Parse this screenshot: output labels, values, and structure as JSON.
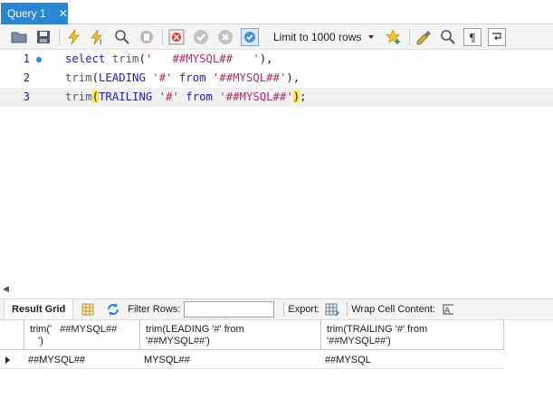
{
  "tab": {
    "title": "Query 1",
    "close_glyph": "✕"
  },
  "toolbar": {
    "icons": [
      "open-folder-icon",
      "save-icon",
      "execute-icon",
      "execute-current-icon",
      "explain-icon",
      "stop-icon",
      "toggle-error-icon",
      "commit-icon",
      "rollback-icon",
      "autocommit-icon"
    ],
    "limit_label": "Limit to 1000 rows",
    "right_icons": [
      "add-snippet-icon",
      "beautify-icon",
      "find-icon",
      "invisible-chars-icon",
      "wrap-icon"
    ]
  },
  "editor": {
    "lines": [
      {
        "number": "1",
        "current": false,
        "tokens": [
          {
            "t": "select",
            "c": "kw"
          },
          {
            "t": " ",
            "c": "punc"
          },
          {
            "t": "trim",
            "c": "fn"
          },
          {
            "t": "(",
            "c": "punc"
          },
          {
            "t": "'   ##MYSQL##   '",
            "c": "str"
          },
          {
            "t": "),",
            "c": "punc"
          }
        ]
      },
      {
        "number": "2",
        "current": false,
        "tokens": [
          {
            "t": "trim",
            "c": "fn"
          },
          {
            "t": "(",
            "c": "punc"
          },
          {
            "t": "LEADING",
            "c": "kw"
          },
          {
            "t": " ",
            "c": "punc"
          },
          {
            "t": "'#'",
            "c": "str"
          },
          {
            "t": " ",
            "c": "punc"
          },
          {
            "t": "from",
            "c": "kw"
          },
          {
            "t": " ",
            "c": "punc"
          },
          {
            "t": "'##MYSQL##'",
            "c": "str"
          },
          {
            "t": "),",
            "c": "punc"
          }
        ]
      },
      {
        "number": "3",
        "current": true,
        "tokens": [
          {
            "t": "trim",
            "c": "fn"
          },
          {
            "t": "(",
            "c": "punc paren-hl"
          },
          {
            "t": "TRAILING",
            "c": "kw"
          },
          {
            "t": " ",
            "c": "punc"
          },
          {
            "t": "'#'",
            "c": "str"
          },
          {
            "t": " ",
            "c": "punc"
          },
          {
            "t": "from",
            "c": "kw"
          },
          {
            "t": " ",
            "c": "punc"
          },
          {
            "t": "'##MYSQL##'",
            "c": "str"
          },
          {
            "t": ")",
            "c": "punc paren-hl"
          },
          {
            "t": ";",
            "c": "punc"
          }
        ]
      }
    ]
  },
  "result_toolbar": {
    "result_grid_label": "Result Grid",
    "filter_label": "Filter Rows:",
    "filter_value": "",
    "export_label": "Export:",
    "wrap_label": "Wrap Cell Content:"
  },
  "grid": {
    "columns": [
      "trim('   ##MYSQL##\n   ')",
      "trim(LEADING '#' from\n'##MYSQL##')",
      "trim(TRAILING '#' from\n'##MYSQL##')"
    ],
    "rows": [
      [
        "##MYSQL##",
        "MYSQL##",
        "##MYSQL"
      ]
    ]
  }
}
